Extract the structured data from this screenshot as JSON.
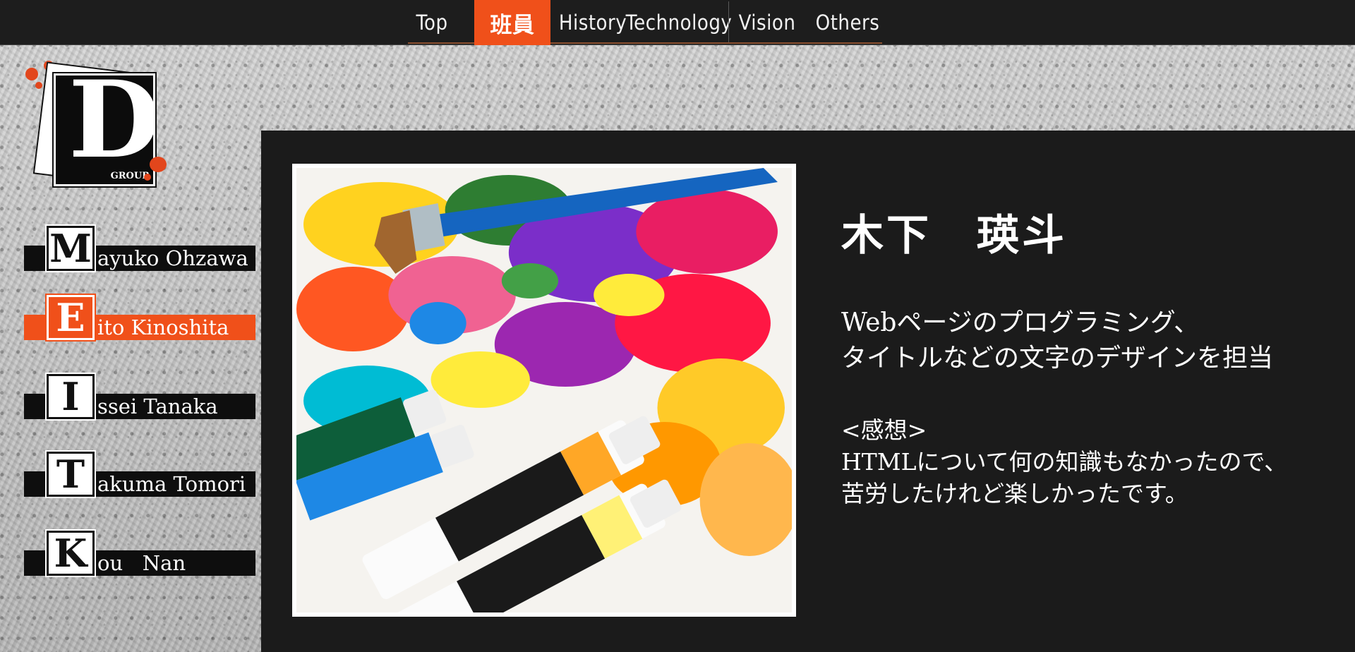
{
  "nav": {
    "items": [
      {
        "label": "Top"
      },
      {
        "label": "班員",
        "active": true
      },
      {
        "label": "History"
      },
      {
        "label": "Technology"
      },
      {
        "label": "Vision"
      },
      {
        "label": "Others"
      }
    ],
    "active_color": "#f0501a"
  },
  "logo": {
    "letter": "D",
    "sub": "GROUP"
  },
  "members": [
    {
      "initial": "M",
      "rest": "ayuko Ohzawa"
    },
    {
      "initial": "E",
      "rest": "ito Kinoshita",
      "active": true
    },
    {
      "initial": "I",
      "rest": "ssei Tanaka"
    },
    {
      "initial": "T",
      "rest": "akuma Tomori"
    },
    {
      "initial": "K",
      "rest": "ou   Nan"
    }
  ],
  "profile": {
    "name": "木下　瑛斗",
    "description": [
      "Webページのプログラミング、",
      "タイトルなどの文字のデザインを担当"
    ],
    "impression_heading": "<感想>",
    "impression": [
      "HTMLについて何の知識もなかったので、",
      "苦労したけれど楽しかったです。"
    ],
    "photo_icon": "paint-palette-photo"
  },
  "colors": {
    "accent": "#f0501a",
    "panel": "#1b1b1b",
    "nav_bg": "#1d1d1d"
  }
}
